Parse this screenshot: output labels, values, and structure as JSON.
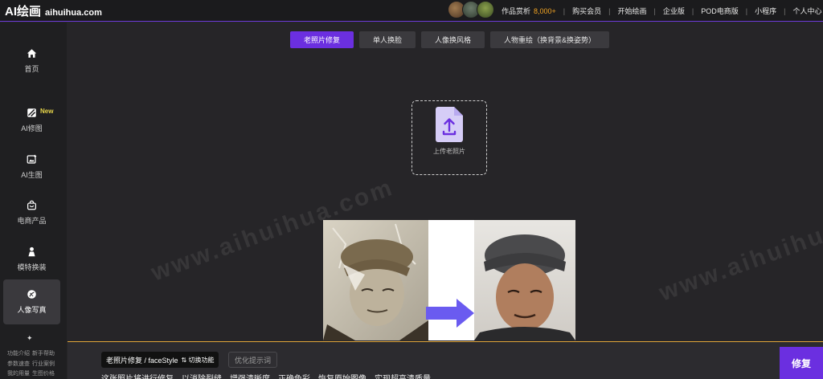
{
  "header": {
    "logo": "AI绘画",
    "domain": "aihuihua.com",
    "nav": {
      "works_label": "作品赏析",
      "works_count": "8,000+",
      "items": [
        "购买会员",
        "开始绘画",
        "企业版",
        "POD电商版",
        "小程序",
        "个人中心"
      ]
    }
  },
  "sidebar": {
    "items": [
      {
        "label": "首页",
        "icon": "home-icon"
      },
      {
        "label": "AI修图",
        "icon": "edit-image-icon",
        "tag": "New"
      },
      {
        "label": "AI生图",
        "icon": "image-generate-icon"
      },
      {
        "label": "电商产品",
        "icon": "shopping-bag-icon"
      },
      {
        "label": "模特换装",
        "icon": "model-icon"
      },
      {
        "label": "人像写真",
        "icon": "portrait-icon"
      }
    ],
    "footer": [
      [
        "功能介绍",
        "新手帮助"
      ],
      [
        "参数速查",
        "行业案例"
      ],
      [
        "我的用量",
        "生图价格"
      ]
    ]
  },
  "tabs": [
    "老照片修复",
    "单人换脸",
    "人像换风格",
    "人物重绘（换背景&换姿势）"
  ],
  "upload": {
    "label": "上传老照片"
  },
  "watermark": "www.aihuihua.com",
  "bottom": {
    "style_label": "老照片修复 / faceStyle",
    "switch_label": "⇅ 切换功能",
    "optimize_label": "优化提示词",
    "description": "这张照片将进行修复，以消除裂缝，增强清晰度，正确色彩，恢复原始图像，实现超高清质量。",
    "fix_label": "修复"
  },
  "colors": {
    "accent": "#6b2fe0",
    "highlight": "#f6a623",
    "new_tag": "#e8d64a"
  }
}
